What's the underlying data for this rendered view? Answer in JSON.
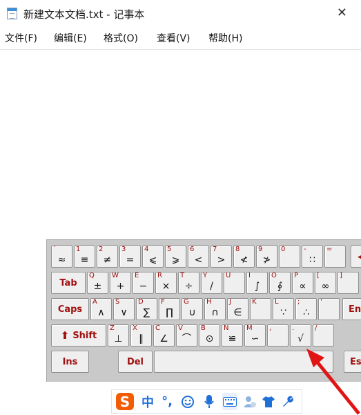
{
  "window": {
    "title": "新建文本文档.txt - 记事本",
    "close_glyph": "✕"
  },
  "menu": [
    "文件(F)",
    "编辑(E)",
    "格式(O)",
    "查看(V)",
    "帮助(H)"
  ],
  "keyboard": {
    "row1": [
      {
        "l": "`",
        "s": "≈"
      },
      {
        "l": "1",
        "s": "≡"
      },
      {
        "l": "2",
        "s": "≠"
      },
      {
        "l": "3",
        "s": "="
      },
      {
        "l": "4",
        "s": "⩽"
      },
      {
        "l": "5",
        "s": "⩾"
      },
      {
        "l": "6",
        "s": "<"
      },
      {
        "l": "7",
        "s": ">"
      },
      {
        "l": "8",
        "s": "≮"
      },
      {
        "l": "9",
        "s": "≯"
      },
      {
        "l": "0",
        "s": ""
      },
      {
        "l": "-",
        "s": "∷"
      },
      {
        "l": "=",
        "s": ""
      }
    ],
    "row1_edge": "◀",
    "tab": "Tab",
    "row2": [
      {
        "l": "Q",
        "s": "±"
      },
      {
        "l": "W",
        "s": "+"
      },
      {
        "l": "E",
        "s": "−"
      },
      {
        "l": "R",
        "s": "×"
      },
      {
        "l": "T",
        "s": "÷"
      },
      {
        "l": "Y",
        "s": "/"
      },
      {
        "l": "U",
        "s": ""
      },
      {
        "l": "I",
        "s": "∫"
      },
      {
        "l": "O",
        "s": "∮"
      },
      {
        "l": "P",
        "s": "∝"
      },
      {
        "l": "[",
        "s": "∞"
      },
      {
        "l": "]",
        "s": ""
      }
    ],
    "caps": "Caps",
    "row3": [
      {
        "l": "A",
        "s": "∧"
      },
      {
        "l": "S",
        "s": "∨"
      },
      {
        "l": "D",
        "s": "∑"
      },
      {
        "l": "F",
        "s": "∏"
      },
      {
        "l": "G",
        "s": "∪"
      },
      {
        "l": "H",
        "s": "∩"
      },
      {
        "l": "J",
        "s": "∈"
      },
      {
        "l": "K",
        "s": ""
      },
      {
        "l": "L",
        "s": "∵"
      },
      {
        "l": ";",
        "s": "∴"
      },
      {
        "l": "'",
        "s": ""
      }
    ],
    "enter": "Ent",
    "shift": "Shift",
    "row4": [
      {
        "l": "Z",
        "s": "⊥"
      },
      {
        "l": "X",
        "s": "∥"
      },
      {
        "l": "C",
        "s": "∠"
      },
      {
        "l": "V",
        "s": "⌒"
      },
      {
        "l": "B",
        "s": "⊙"
      },
      {
        "l": "N",
        "s": "≌"
      },
      {
        "l": "M",
        "s": "∽"
      },
      {
        "l": ",",
        "s": ""
      },
      {
        "l": ".",
        "s": "√"
      },
      {
        "l": "/",
        "s": ""
      }
    ],
    "ins": "Ins",
    "del": "Del",
    "esc": "Es"
  },
  "ime_toolbar": {
    "logo": "S",
    "lang": "中",
    "punct": "°,"
  }
}
